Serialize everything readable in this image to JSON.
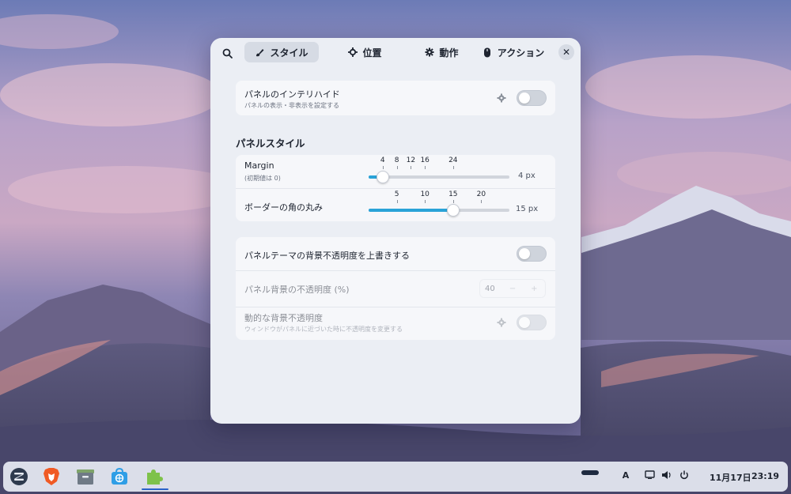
{
  "tabs": [
    {
      "label": "スタイル",
      "icon": "brush-icon",
      "active": true
    },
    {
      "label": "位置",
      "icon": "crosshair-icon",
      "active": false
    },
    {
      "label": "動作",
      "icon": "gear-icon",
      "active": false
    },
    {
      "label": "アクション",
      "icon": "mouse-icon",
      "active": false
    }
  ],
  "intellihide": {
    "title": "パネルのインテリハイド",
    "subtitle": "パネルの表示・非表示を設定する"
  },
  "panel_style": {
    "section_title": "パネルスタイル",
    "margin": {
      "title": "Margin",
      "subtitle": "(初期値は 0)",
      "ticks": [
        "4",
        "8",
        "12",
        "16",
        "24"
      ],
      "value": 4,
      "value_text": "4 px",
      "min": 0,
      "max": 40
    },
    "radius": {
      "title": "ボーダーの角の丸み",
      "ticks": [
        "5",
        "10",
        "15",
        "20"
      ],
      "value": 15,
      "value_text": "15 px",
      "min": 0,
      "max": 25
    }
  },
  "opacity": {
    "override_title": "パネルテーマの背景不透明度を上書きする",
    "bg_title": "パネル背景の不透明度 (%)",
    "bg_value": "40",
    "bg_minus": "−",
    "bg_plus": "+",
    "dynamic_title": "動的な背景不透明度",
    "dynamic_subtitle": "ウィンドウがパネルに近づいた時に不透明度を変更する"
  },
  "taskbar": {
    "apps": [
      "zorin-menu-icon",
      "brave-browser-icon",
      "files-icon",
      "software-store-icon",
      "extensions-icon"
    ],
    "input_method": "A",
    "date": "11月17日",
    "time": "23:19"
  },
  "colors": {
    "accent": "#2aa3d8",
    "window_bg": "#ebeef4",
    "card_bg": "#f6f7fa",
    "taskbar_active": "#2a62c8"
  }
}
